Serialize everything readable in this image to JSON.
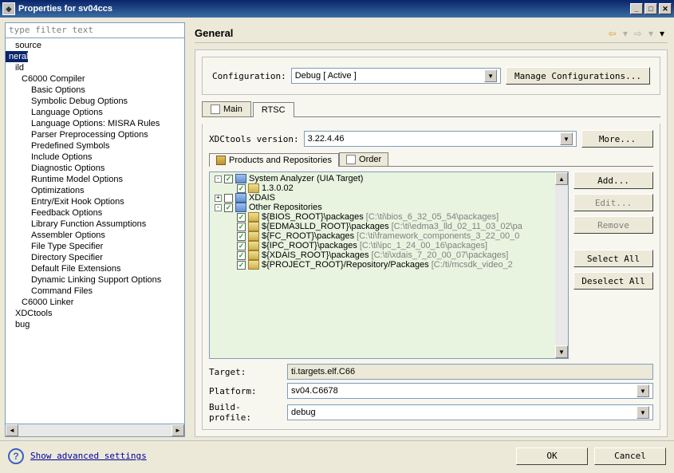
{
  "window": {
    "title": "Properties for sv04ccs"
  },
  "filter_placeholder": "type filter text",
  "nav_tree": [
    {
      "t": "source",
      "cls": "ind5"
    },
    {
      "t": "neral",
      "cls": "sel"
    },
    {
      "t": "ild",
      "cls": "ind5"
    },
    {
      "t": "C6000 Compiler",
      "cls": "ind1"
    },
    {
      "t": "Basic Options",
      "cls": "ind2"
    },
    {
      "t": "Symbolic Debug Options",
      "cls": "ind2"
    },
    {
      "t": "Language Options",
      "cls": "ind2"
    },
    {
      "t": "Language Options: MISRA Rules",
      "cls": "ind2"
    },
    {
      "t": "Parser Preprocessing Options",
      "cls": "ind2"
    },
    {
      "t": "Predefined Symbols",
      "cls": "ind2"
    },
    {
      "t": "Include Options",
      "cls": "ind2"
    },
    {
      "t": "Diagnostic Options",
      "cls": "ind2"
    },
    {
      "t": "Runtime Model Options",
      "cls": "ind2"
    },
    {
      "t": "Optimizations",
      "cls": "ind2"
    },
    {
      "t": "Entry/Exit Hook Options",
      "cls": "ind2"
    },
    {
      "t": "Feedback Options",
      "cls": "ind2"
    },
    {
      "t": "Library Function Assumptions",
      "cls": "ind2"
    },
    {
      "t": "Assembler Options",
      "cls": "ind2"
    },
    {
      "t": "File Type Specifier",
      "cls": "ind2"
    },
    {
      "t": "Directory Specifier",
      "cls": "ind2"
    },
    {
      "t": "Default File Extensions",
      "cls": "ind2"
    },
    {
      "t": "Dynamic Linking Support Options",
      "cls": "ind2"
    },
    {
      "t": "Command Files",
      "cls": "ind2"
    },
    {
      "t": "C6000 Linker",
      "cls": "ind1"
    },
    {
      "t": "XDCtools",
      "cls": "ind5"
    },
    {
      "t": "bug",
      "cls": "ind5"
    }
  ],
  "right": {
    "title": "General",
    "config_label": "Configuration:",
    "config_value": "Debug  [ Active ]",
    "manage_btn": "Manage Configurations...",
    "tabs": {
      "main": "Main",
      "rtsc": "RTSC"
    },
    "xdc_label": "XDCtools version:",
    "xdc_value": "3.22.4.46",
    "more_btn": "More...",
    "subtabs": {
      "products": "Products and Repositories",
      "order": "Order"
    },
    "sidebtns": {
      "add": "Add...",
      "edit": "Edit...",
      "remove": "Remove",
      "select_all": "Select All",
      "deselect_all": "Deselect All"
    },
    "repos": [
      {
        "lvl": "ind-a",
        "exp": "-",
        "chk": true,
        "icon": "blue",
        "txt": "System Analyzer (UIA Target)",
        "path": ""
      },
      {
        "lvl": "ind-b",
        "exp": "",
        "chk": true,
        "icon": "pkg",
        "txt": "1.3.0.02",
        "path": ""
      },
      {
        "lvl": "ind-a",
        "exp": "+",
        "chk": false,
        "icon": "blue",
        "txt": "XDAIS",
        "path": ""
      },
      {
        "lvl": "ind-a",
        "exp": "-",
        "chk": true,
        "icon": "blue",
        "txt": "Other Repositories",
        "path": ""
      },
      {
        "lvl": "ind-b",
        "exp": "",
        "chk": true,
        "icon": "pkg",
        "txt": "${BIOS_ROOT}\\packages",
        "path": "[C:\\ti\\bios_6_32_05_54\\packages]"
      },
      {
        "lvl": "ind-b",
        "exp": "",
        "chk": true,
        "icon": "pkg",
        "txt": "${EDMA3LLD_ROOT}\\packages",
        "path": "[C:\\ti\\edma3_lld_02_11_03_02\\pa"
      },
      {
        "lvl": "ind-b",
        "exp": "",
        "chk": true,
        "icon": "pkg",
        "txt": "${FC_ROOT}\\packages",
        "path": "[C:\\ti\\framework_components_3_22_00_0"
      },
      {
        "lvl": "ind-b",
        "exp": "",
        "chk": true,
        "icon": "pkg",
        "txt": "${IPC_ROOT}\\packages",
        "path": "[C:\\ti\\ipc_1_24_00_16\\packages]"
      },
      {
        "lvl": "ind-b",
        "exp": "",
        "chk": true,
        "icon": "pkg",
        "txt": "${XDAIS_ROOT}\\packages",
        "path": "[C:\\ti\\xdais_7_20_00_07\\packages]"
      },
      {
        "lvl": "ind-b",
        "exp": "",
        "chk": true,
        "icon": "pkg",
        "txt": "${PROJECT_ROOT}/Repository/Packages",
        "path": "[C:/ti/mcsdk_video_2"
      }
    ],
    "target_label": "Target:",
    "target_value": "ti.targets.elf.C66",
    "platform_label": "Platform:",
    "platform_value": "sv04.C6678",
    "profile_label": "Build-profile:",
    "profile_value": "debug"
  },
  "bottom": {
    "advanced": "Show advanced settings",
    "ok": "OK",
    "cancel": "Cancel"
  }
}
